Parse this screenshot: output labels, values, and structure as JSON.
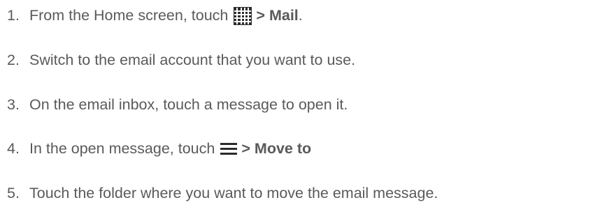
{
  "steps": [
    {
      "number": "1.",
      "text_before": "From the Home screen, touch",
      "icon": "apps-grid-icon",
      "separator": ">",
      "bold_text": "Mail",
      "text_after": "."
    },
    {
      "number": "2.",
      "text": "Switch to the email account that you want to use."
    },
    {
      "number": "3.",
      "text": "On the email inbox, touch a message to open it."
    },
    {
      "number": "4.",
      "text_before": "In the open message, touch",
      "icon": "menu-icon",
      "separator": ">",
      "bold_text": "Move to"
    },
    {
      "number": "5.",
      "text": "Touch the folder where you want to move the email message."
    }
  ],
  "colors": {
    "text": "#5a5a5a",
    "icon_dark": "#2b2b2b"
  }
}
